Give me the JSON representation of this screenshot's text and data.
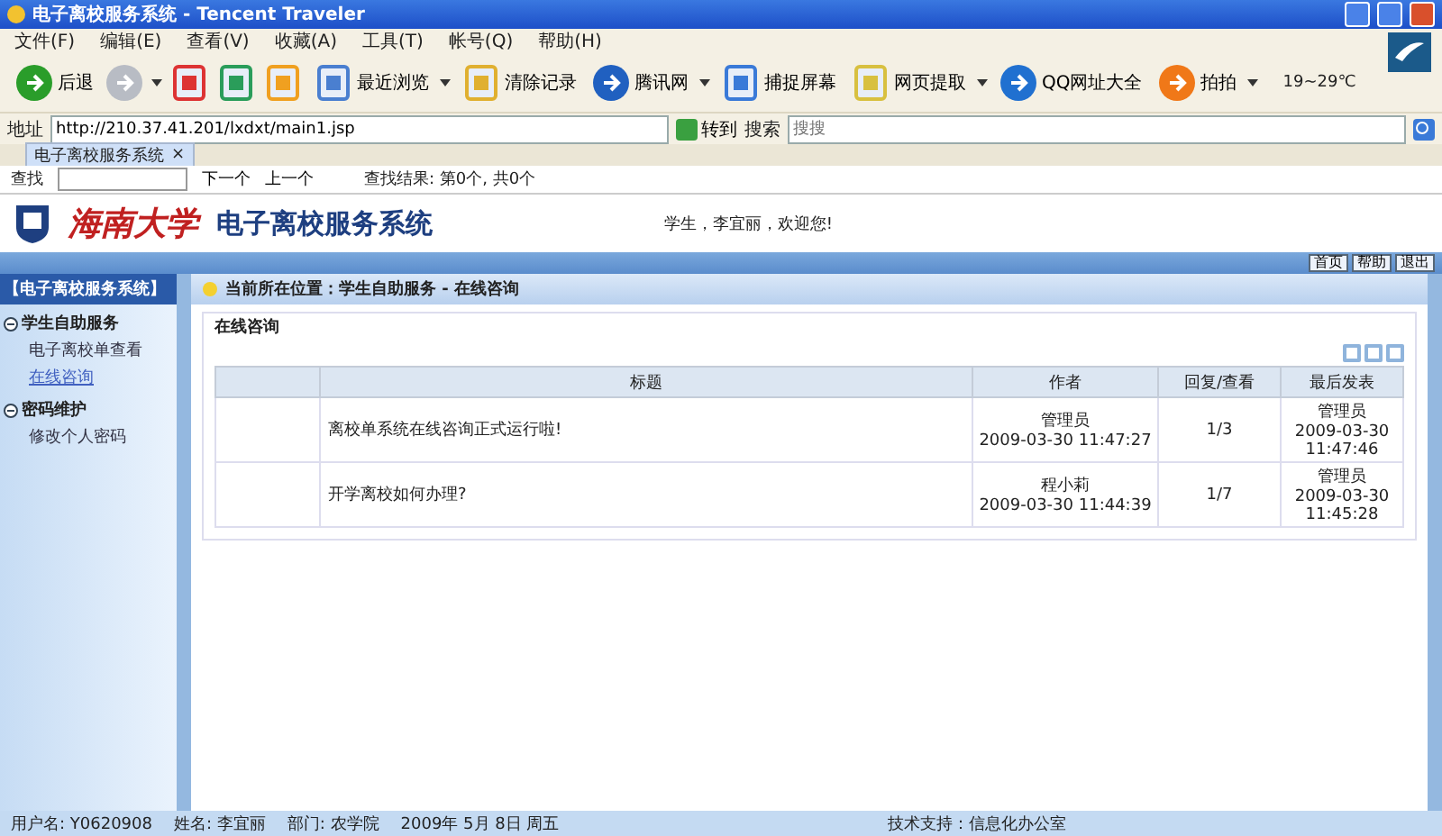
{
  "window": {
    "title": "电子离校服务系统 - Tencent Traveler"
  },
  "menu": [
    "文件(F)",
    "编辑(E)",
    "查看(V)",
    "收藏(A)",
    "工具(T)",
    "帐号(Q)",
    "帮助(H)"
  ],
  "toolbar": [
    {
      "label": "后退",
      "dropdown": false
    },
    {
      "dropdown": true
    },
    {
      "dropdown": false
    },
    {
      "dropdown": false
    },
    {
      "dropdown": false
    },
    {
      "label": "最近浏览",
      "dropdown": true
    },
    {
      "label": "清除记录",
      "dropdown": false
    },
    {
      "label": "腾讯网",
      "dropdown": true
    },
    {
      "label": "捕捉屏幕",
      "dropdown": false
    },
    {
      "label": "网页提取",
      "dropdown": true
    },
    {
      "label": "QQ网址大全",
      "dropdown": false
    },
    {
      "label": "拍拍",
      "dropdown": true
    }
  ],
  "weather": "19~29℃",
  "address": {
    "label": "地址",
    "value": "http://210.37.41.201/lxdxt/main1.jsp",
    "go": "转到",
    "search_label": "搜索",
    "search_placeholder": "搜搜"
  },
  "tabs": [
    {
      "label": "电子离校服务系统",
      "selected": true,
      "close": "×"
    }
  ],
  "find_bar": {
    "label": "查找",
    "next": "下一个",
    "prev": "上一个",
    "result": "查找结果: 第0个, 共0个"
  },
  "header": {
    "university": "海南大学",
    "system": "电子离校服务系统",
    "welcome": "学生，李宜丽，欢迎您!",
    "buttons": [
      "首页",
      "帮助",
      "退出"
    ]
  },
  "sidebar": {
    "title": "【电子离校服务系统】",
    "sections": [
      {
        "label": "学生自助服务",
        "items": [
          {
            "label": "电子离校单查看",
            "selected": false
          },
          {
            "label": "在线咨询",
            "selected": true
          }
        ]
      },
      {
        "label": "密码维护",
        "items": [
          {
            "label": "修改个人密码",
            "selected": false
          }
        ]
      }
    ]
  },
  "breadcrumb": "当前所在位置：学生自助服务 - 在线咨询",
  "panel": {
    "title": "在线咨询",
    "table": {
      "columns": [
        "",
        "标题",
        "作者",
        "回复/查看",
        "最后发表"
      ],
      "rows": [
        {
          "title": "离校单系统在线咨询正式运行啦!",
          "author": "管理员",
          "posted": "2009-03-30 11:47:27",
          "replies": "1/3",
          "last_by": "管理员",
          "last_date": "2009-03-30",
          "last_time": "11:47:46"
        },
        {
          "title": "开学离校如何办理?",
          "author": "程小莉",
          "posted": "2009-03-30 11:44:39",
          "replies": "1/7",
          "last_by": "管理员",
          "last_date": "2009-03-30",
          "last_time": "11:45:28"
        }
      ]
    }
  },
  "status_bar": {
    "left": [
      "用户名: Y0620908",
      "姓名: 李宜丽",
      "部门: 农学院",
      "2009年 5月 8日 周五"
    ],
    "right": "技术支持：信息化办公室"
  }
}
